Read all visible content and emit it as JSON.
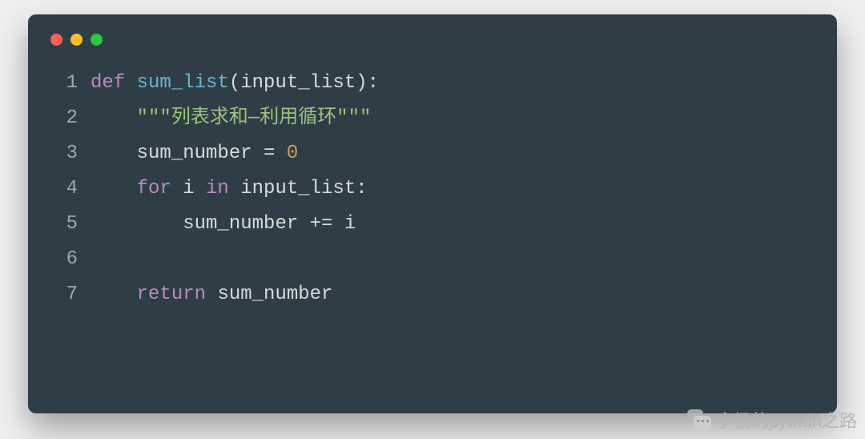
{
  "code": {
    "lines": [
      {
        "n": "1",
        "tokens": [
          {
            "cls": "tok-keyword",
            "t": "def "
          },
          {
            "cls": "tok-funcname",
            "t": "sum_list"
          },
          {
            "cls": "tok-paren",
            "t": "("
          },
          {
            "cls": "tok-param",
            "t": "input_list"
          },
          {
            "cls": "tok-paren",
            "t": ")"
          },
          {
            "cls": "tok-colon",
            "t": ":"
          }
        ]
      },
      {
        "n": "2",
        "tokens": [
          {
            "cls": "",
            "t": "    "
          },
          {
            "cls": "tok-string",
            "t": "\"\"\"列表求和—利用循环\"\"\""
          }
        ]
      },
      {
        "n": "3",
        "tokens": [
          {
            "cls": "",
            "t": "    "
          },
          {
            "cls": "tok-ident",
            "t": "sum_number "
          },
          {
            "cls": "tok-op",
            "t": "= "
          },
          {
            "cls": "tok-number",
            "t": "0"
          }
        ]
      },
      {
        "n": "4",
        "tokens": [
          {
            "cls": "",
            "t": "    "
          },
          {
            "cls": "tok-keyword",
            "t": "for "
          },
          {
            "cls": "tok-ident",
            "t": "i "
          },
          {
            "cls": "tok-keyword",
            "t": "in "
          },
          {
            "cls": "tok-ident",
            "t": "input_list"
          },
          {
            "cls": "tok-colon",
            "t": ":"
          }
        ]
      },
      {
        "n": "5",
        "tokens": [
          {
            "cls": "",
            "t": "        "
          },
          {
            "cls": "tok-ident",
            "t": "sum_number "
          },
          {
            "cls": "tok-op",
            "t": "+= "
          },
          {
            "cls": "tok-ident",
            "t": "i"
          }
        ]
      },
      {
        "n": "6",
        "tokens": []
      },
      {
        "n": "7",
        "tokens": [
          {
            "cls": "",
            "t": "    "
          },
          {
            "cls": "tok-keyword",
            "t": "return "
          },
          {
            "cls": "tok-ident",
            "t": "sum_number"
          }
        ]
      }
    ]
  },
  "watermark": {
    "text": "小杨的python之路"
  }
}
